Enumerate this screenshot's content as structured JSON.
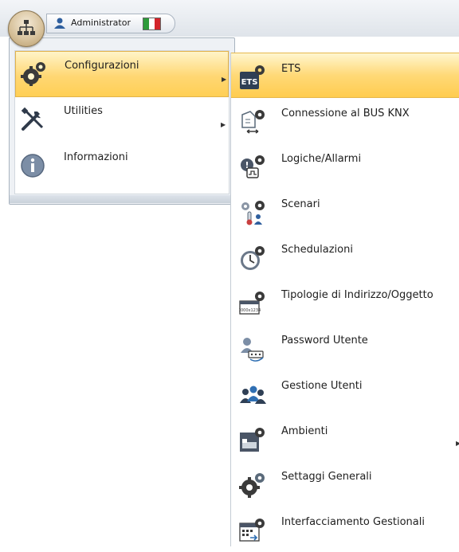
{
  "header": {
    "user_name": "Administrator",
    "flag_colors": [
      "#2e9a3a",
      "#ffffff",
      "#d3242a"
    ]
  },
  "main_menu": {
    "items": [
      {
        "label": "Configurazioni",
        "icon": "gear-icon",
        "has_submenu": true,
        "active": true
      },
      {
        "label": "Utilities",
        "icon": "tools-icon",
        "has_submenu": true,
        "active": false
      },
      {
        "label": "Informazioni",
        "icon": "info-icon",
        "has_submenu": false,
        "active": false
      }
    ]
  },
  "submenu": {
    "items": [
      {
        "label": "ETS",
        "icon": "ets-icon",
        "active": true
      },
      {
        "label": "Connessione al BUS KNX",
        "icon": "bus-connection-icon"
      },
      {
        "label": "Logiche/Allarmi",
        "icon": "logic-alarm-icon"
      },
      {
        "label": "Scenari",
        "icon": "scenario-icon"
      },
      {
        "label": "Schedulazioni",
        "icon": "schedule-clock-icon"
      },
      {
        "label": "Tipologie di Indirizzo/Oggetto",
        "icon": "address-type-icon",
        "icon_text": "0000x1234"
      },
      {
        "label": "Password Utente",
        "icon": "user-password-icon"
      },
      {
        "label": "Gestione Utenti",
        "icon": "users-icon"
      },
      {
        "label": "Ambienti",
        "icon": "room-icon",
        "has_submenu": true
      },
      {
        "label": "Settaggi Generali",
        "icon": "gear-icon"
      },
      {
        "label": "Interfacciamento Gestionali",
        "icon": "calendar-interface-icon"
      }
    ]
  },
  "colors": {
    "highlight": "#ffd773",
    "accent_blue": "#2f6fb3"
  }
}
